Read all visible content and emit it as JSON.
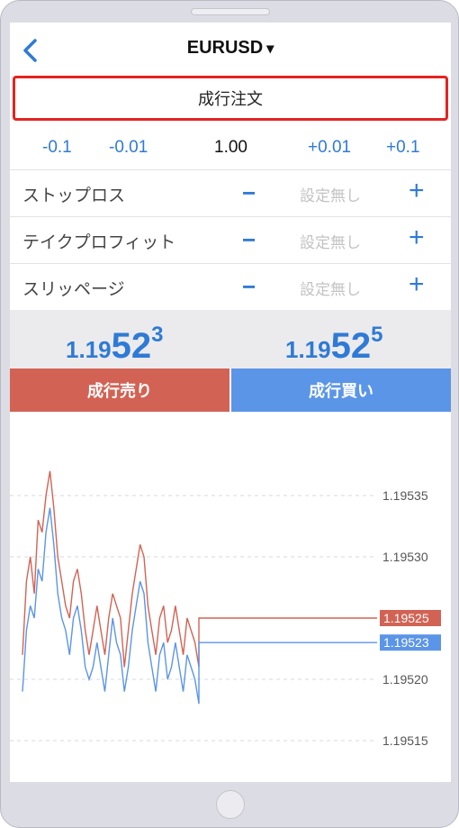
{
  "header": {
    "symbol": "EURUSD",
    "caret": "▾"
  },
  "order_type": "成行注文",
  "lot": {
    "minus_big": "-0.1",
    "minus_small": "-0.01",
    "value": "1.00",
    "plus_small": "+0.01",
    "plus_big": "+0.1"
  },
  "settings": [
    {
      "label": "ストップロス",
      "minus": "−",
      "value": "設定無し",
      "plus": "+"
    },
    {
      "label": "テイクプロフィット",
      "minus": "−",
      "value": "設定無し",
      "plus": "+"
    },
    {
      "label": "スリッページ",
      "minus": "−",
      "value": "設定無し",
      "plus": "+"
    }
  ],
  "prices": {
    "bid": {
      "small": "1.19",
      "big": "52",
      "sup": "3"
    },
    "ask": {
      "small": "1.19",
      "big": "52",
      "sup": "5"
    }
  },
  "actions": {
    "sell": "成行売り",
    "buy": "成行買い"
  },
  "colors": {
    "accent": "#2f7ad6",
    "sell": "#d26354",
    "buy": "#5b95e7",
    "order_border": "#e52321"
  },
  "chart_data": {
    "type": "line",
    "ylim": [
      1.19512,
      1.19538
    ],
    "y_ticks": [
      "1.19535",
      "1.19530",
      "1.19520",
      "1.19515"
    ],
    "tick_values": [
      1.19535,
      1.1953,
      1.1952,
      1.19515
    ],
    "series": [
      {
        "color": "#d26354",
        "last_label": "1.19525",
        "values": [
          1.19522,
          1.19528,
          1.1953,
          1.19527,
          1.19533,
          1.19532,
          1.19535,
          1.19537,
          1.19534,
          1.1953,
          1.19528,
          1.19526,
          1.19525,
          1.19528,
          1.19529,
          1.19527,
          1.19524,
          1.19522,
          1.19524,
          1.19526,
          1.19524,
          1.19522,
          1.19525,
          1.19527,
          1.19526,
          1.19525,
          1.19521,
          1.19524,
          1.19527,
          1.19529,
          1.19531,
          1.1953,
          1.19526,
          1.19524,
          1.19522,
          1.19525,
          1.19526,
          1.19523,
          1.19524,
          1.19526,
          1.19524,
          1.19522,
          1.19525,
          1.19524,
          1.19523,
          1.19521,
          1.19525,
          1.19525,
          1.19525,
          1.19525,
          1.19525
        ]
      },
      {
        "color": "#5b95e7",
        "last_label": "1.19523",
        "values": [
          1.19519,
          1.19524,
          1.19526,
          1.19525,
          1.19529,
          1.19528,
          1.19532,
          1.19534,
          1.19531,
          1.19527,
          1.19525,
          1.19524,
          1.19522,
          1.19525,
          1.19526,
          1.19524,
          1.19521,
          1.1952,
          1.19521,
          1.19523,
          1.19521,
          1.19519,
          1.19522,
          1.19525,
          1.19523,
          1.19522,
          1.19519,
          1.19521,
          1.19524,
          1.19526,
          1.19528,
          1.19527,
          1.19523,
          1.19521,
          1.19519,
          1.19522,
          1.19523,
          1.1952,
          1.19521,
          1.19523,
          1.19521,
          1.19519,
          1.19522,
          1.19521,
          1.1952,
          1.19518,
          1.19523,
          1.19523,
          1.19523,
          1.19523,
          1.19523
        ]
      }
    ]
  }
}
